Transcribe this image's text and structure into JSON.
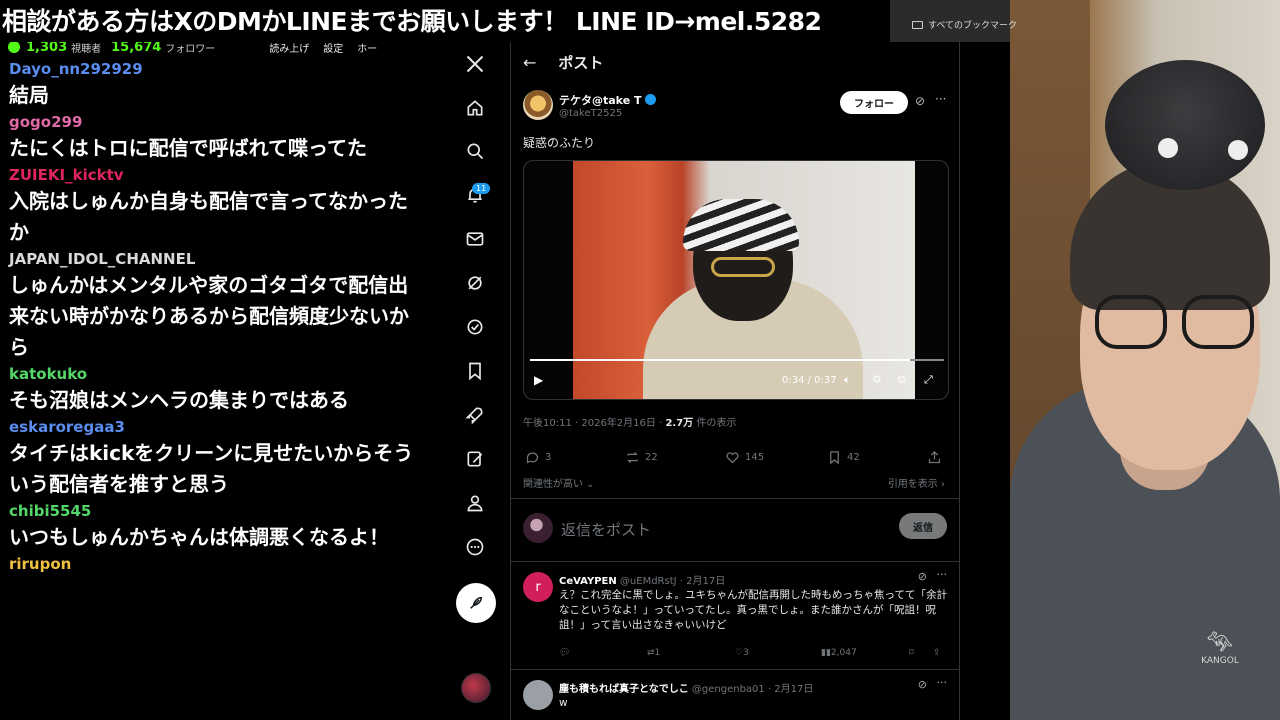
{
  "banner": {
    "text": "相談がある方はXのDMかLINEまでお願いします！ LINE ID→mel.5282",
    "bookmarks": "すべてのブックマーク"
  },
  "chat": {
    "stats": {
      "viewers": "1,303",
      "viewers_label": "視聴者",
      "followers": "15,674",
      "followers_label": "フォロワー",
      "read_label": "読み上げ",
      "settings_label": "設定",
      "home_label": "ホー"
    },
    "messages": [
      {
        "user": "Dayo_nn292929",
        "color": "#5b8cf0",
        "text": "結局"
      },
      {
        "user": "gogo299",
        "color": "#e06aa8",
        "text": "たにくはトロに配信で呼ばれて喋ってた"
      },
      {
        "user": "ZUIEKI_kicktv",
        "color": "#e0245e",
        "text": "入院はしゅんか自身も配信で言ってなかったか"
      },
      {
        "user": "JAPAN_IDOL_CHANNEL",
        "color": "#d9d9d9",
        "text": "しゅんかはメンタルや家のゴタゴタで配信出来ない時がかなりあるから配信頻度少ないから"
      },
      {
        "user": "katokuko",
        "color": "#53d769",
        "text": "そも沼娘はメンヘラの集まりではある"
      },
      {
        "user": "eskaroregaa3",
        "color": "#5b8cf0",
        "text": "タイチはkickをクリーンに見せたいからそういう配信者を推すと思う"
      },
      {
        "user": "chibi5545",
        "color": "#53d769",
        "text": "いつもしゅんかちゃんは体調悪くなるよ！"
      },
      {
        "user": "rirupon",
        "color": "#f0c040",
        "text": ""
      }
    ]
  },
  "nav": {
    "notif_count": "11",
    "icons": [
      "x-logo-icon",
      "home-icon",
      "search-icon",
      "bell-icon",
      "mail-icon",
      "grok-icon",
      "verified-icon",
      "bookmark-icon",
      "rocket-icon",
      "edit-icon",
      "profile-icon",
      "more-icon"
    ]
  },
  "post": {
    "header_title": "ポスト",
    "back": "←",
    "author_name": "テケタ@take T",
    "author_handle": "@takeT2525",
    "follow_label": "フォロー",
    "text": "疑惑のふたり",
    "video": {
      "time": "0:34 / 0:37",
      "progress": 0.919
    },
    "meta_time": "午後10:11 · 2026年2月16日 · ",
    "meta_views": "2.7万",
    "meta_views_suffix": " 件の表示",
    "stats": {
      "replies": "3",
      "reposts": "22",
      "likes": "145",
      "bookmarks": "42"
    },
    "relevance_label": "関連性が高い ⌄",
    "quotes_label": "引用を表示 ›",
    "reply_placeholder": "返信をポスト",
    "reply_button": "返信"
  },
  "replies": [
    {
      "name": "CeVAYPEN",
      "handle": "@uEMdRstJ · 2月17日",
      "avatar_letter": "r",
      "avatar_color": "#d11f5e",
      "body": "え？これ完全に黒でしょ。ユキちゃんが配信再開した時もめっちゃ焦ってて「余計なこというなよ！」っていってたし。真っ黒でしょ。また誰かさんが「呪詛！呪詛！」って言い出さなきゃいいけど",
      "reposts": "1",
      "likes": "3",
      "views": "2,047"
    },
    {
      "name": "塵も積もれば真子となでしこ",
      "handle": "@gengenba01 · 2月17日",
      "avatar_letter": "",
      "avatar_color": "#9aa0a6",
      "body": "w"
    }
  ],
  "cam": {
    "hoodie_logo": "KANGOL"
  }
}
